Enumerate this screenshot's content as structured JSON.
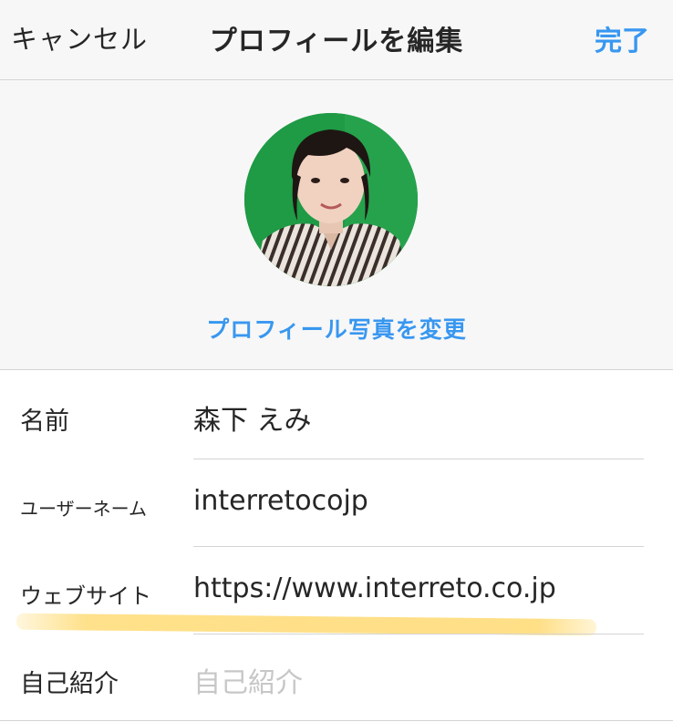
{
  "nav": {
    "cancel_label": "キャンセル",
    "title": "プロフィールを編集",
    "done_label": "完了"
  },
  "profile_photo": {
    "change_label": "プロフィール写真を変更"
  },
  "fields": [
    {
      "label": "名前",
      "value": "森下 えみ"
    },
    {
      "label": "ユーザーネーム",
      "value": "interretocojp"
    },
    {
      "label": "ウェブサイト",
      "value": "https://www.interreto.co.jp"
    },
    {
      "label": "自己紹介",
      "value": "",
      "placeholder": "自己紹介"
    }
  ],
  "colors": {
    "accent": "#3897f0",
    "text": "#262626",
    "placeholder": "#c7c7c7",
    "nav_background": "#f7f7f7",
    "highlight": "#ffd55f"
  }
}
